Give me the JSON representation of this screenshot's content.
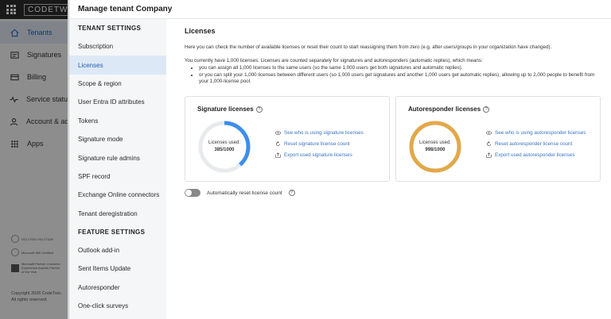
{
  "app": {
    "brand": "CODETWO",
    "nav": [
      {
        "label": "Tenants",
        "icon": "home-icon",
        "active": true
      },
      {
        "label": "Signatures",
        "icon": "signature-icon",
        "active": false
      },
      {
        "label": "Billing",
        "icon": "billing-icon",
        "active": false
      },
      {
        "label": "Service status",
        "icon": "pulse-icon",
        "active": false
      },
      {
        "label": "Account & adm",
        "icon": "account-icon",
        "active": false
      },
      {
        "label": "Apps",
        "icon": "apps-icon",
        "active": false
      }
    ],
    "badges": [
      "ISO 27001 ISO 27018",
      "Microsoft 365 Certified",
      "Microsoft Partner Customer Experience Awards Partner of the Year"
    ],
    "copyright": "Copyright 2026 CodeTwo. All rights reserved."
  },
  "panel": {
    "title": "Manage tenant Company",
    "tenant_section": "TENANT SETTINGS",
    "tenant_items": [
      "Subscription",
      "Licenses",
      "Scope & region",
      "User Entra ID attributes",
      "Tokens",
      "Signature mode",
      "Signature rule admins",
      "SPF record",
      "Exchange Online connectors",
      "Tenant deregistration"
    ],
    "active_item": "Licenses",
    "feature_section": "FEATURE SETTINGS",
    "feature_items": [
      "Outlook add-in",
      "Sent Items Update",
      "Autoresponder",
      "One-click surveys"
    ]
  },
  "licenses": {
    "heading": "Licenses",
    "intro": "Here you can check the number of available licenses or reset their count to start reassigning them from zero (e.g. after users/groups in your organization have changed).",
    "count_text": "You currently have 1,000 licenses. Licenses are counted separately for signatures and autoresponders (automatic replies), which means:",
    "bullets": [
      "you can assign all 1,000 licenses to the same users (so the same 1,000 users get both signatures and automatic replies).",
      "or you can split your 1,000 licenses between different users (so 1,000 users get signatures and another 1,000 users get automatic replies), allowing up to 2,000 people to benefit from your 1,000-license pool."
    ],
    "signature": {
      "title": "Signature licenses",
      "used_label": "Licenses used:",
      "used_value": "385/1000",
      "used": 385,
      "total": 1000,
      "color": "#3d8eea",
      "links": [
        "See who is using signature licenses",
        "Reset signature license count",
        "Export used signature licenses"
      ]
    },
    "autoresponder": {
      "title": "Autoresponder licenses",
      "used_label": "Licenses used:",
      "used_value": "998/1000",
      "used": 998,
      "total": 1000,
      "color": "#e2a84a",
      "links": [
        "See who is using autoresponder licenses",
        "Reset autoresponder license count",
        "Export used autoresponder licenses"
      ]
    },
    "auto_reset_label": "Automatically reset license count",
    "auto_reset_on": false
  }
}
